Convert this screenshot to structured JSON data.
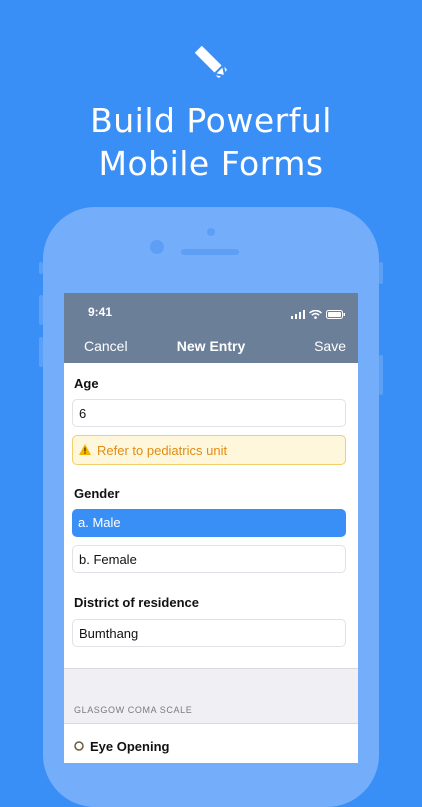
{
  "hero": {
    "icon": "pencil-ruler-icon",
    "headline_line1": "Build Powerful",
    "headline_line2": "Mobile Forms"
  },
  "status_bar": {
    "time": "9:41",
    "icons": [
      "signal-icon",
      "wifi-icon",
      "battery-icon"
    ]
  },
  "nav": {
    "cancel_label": "Cancel",
    "title": "New Entry",
    "save_label": "Save"
  },
  "form": {
    "age_label": "Age",
    "age_value": "6",
    "warning_icon": "warning-icon",
    "warning_text": "Refer to pediatrics unit",
    "gender_label": "Gender",
    "gender_options": [
      "a. Male",
      "b. Female"
    ],
    "gender_selected": "a. Male",
    "district_label": "District of residence",
    "district_value": "Bumthang",
    "section_header": "GLASGOW COMA SCALE",
    "next_item_label": "Eye Opening"
  },
  "colors": {
    "background": "#3a8ff7",
    "phone_frame": "#74adf9",
    "navbar": "#6b7f99",
    "selected": "#3a8ff7",
    "warning_text": "#e08c13",
    "warning_bg": "#fff7dc"
  }
}
